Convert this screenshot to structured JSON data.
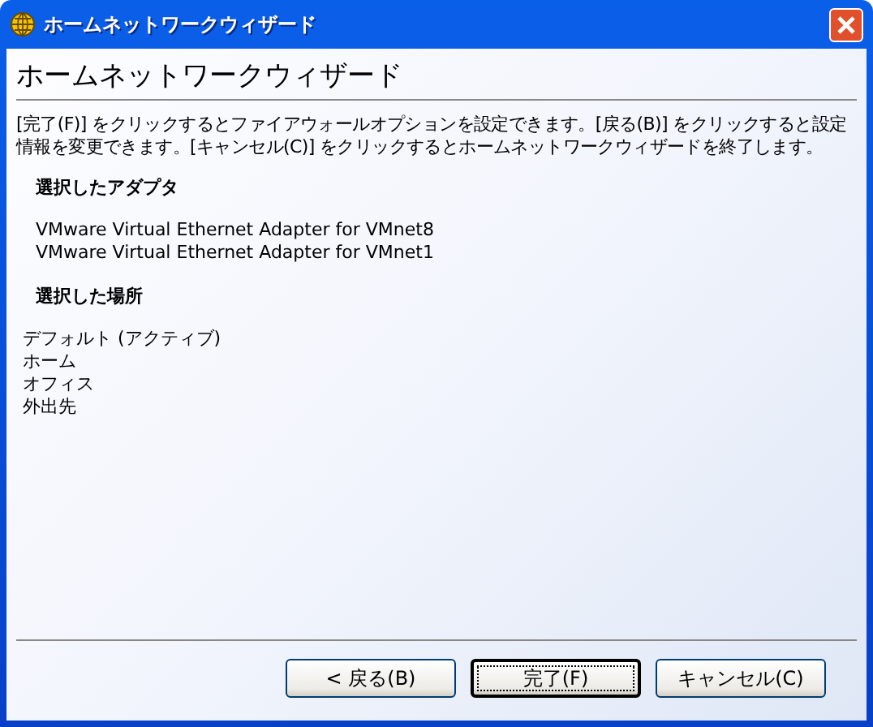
{
  "window": {
    "title": "ホームネットワークウィザード"
  },
  "heading": "ホームネットワークウィザード",
  "intro": "[完了(F)] をクリックするとファイアウォールオプションを設定できます。[戻る(B)] をクリックすると設定情報を変更できます。[キャンセル(C)] をクリックするとホームネットワークウィザードを終了します。",
  "sections": [
    {
      "heading": "選択したアダプタ",
      "items": [
        "VMware Virtual Ethernet Adapter for VMnet8",
        "VMware Virtual Ethernet Adapter for VMnet1"
      ]
    },
    {
      "heading": "選択した場所",
      "items": [
        "デフォルト (アクティブ)",
        "ホーム",
        "オフィス",
        "外出先"
      ]
    }
  ],
  "buttons": [
    {
      "label": "< 戻る(B)",
      "default": false
    },
    {
      "label": "完了(F)",
      "default": true
    },
    {
      "label": "キャンセル(C)",
      "default": false
    }
  ]
}
